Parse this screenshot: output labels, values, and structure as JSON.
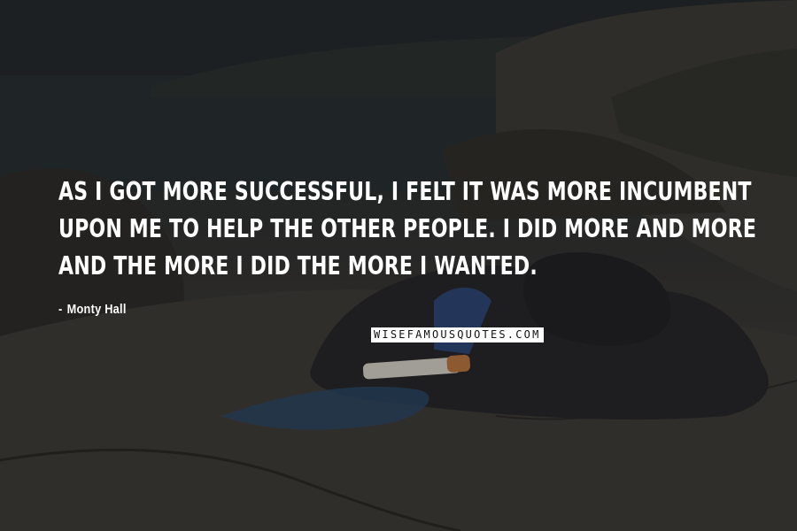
{
  "quote": {
    "text": "As I got more successful, I felt it was more incumbent upon me to help the other people. I did more and more and the more I did the more I wanted.",
    "author": "Monty Hall",
    "dash": "-"
  },
  "watermark": {
    "text": "WISEFAMOUSQUOTES.COM"
  },
  "colors": {
    "text": "#ffffff",
    "watermark_bg": "#ffffff",
    "watermark_text": "#111111"
  }
}
